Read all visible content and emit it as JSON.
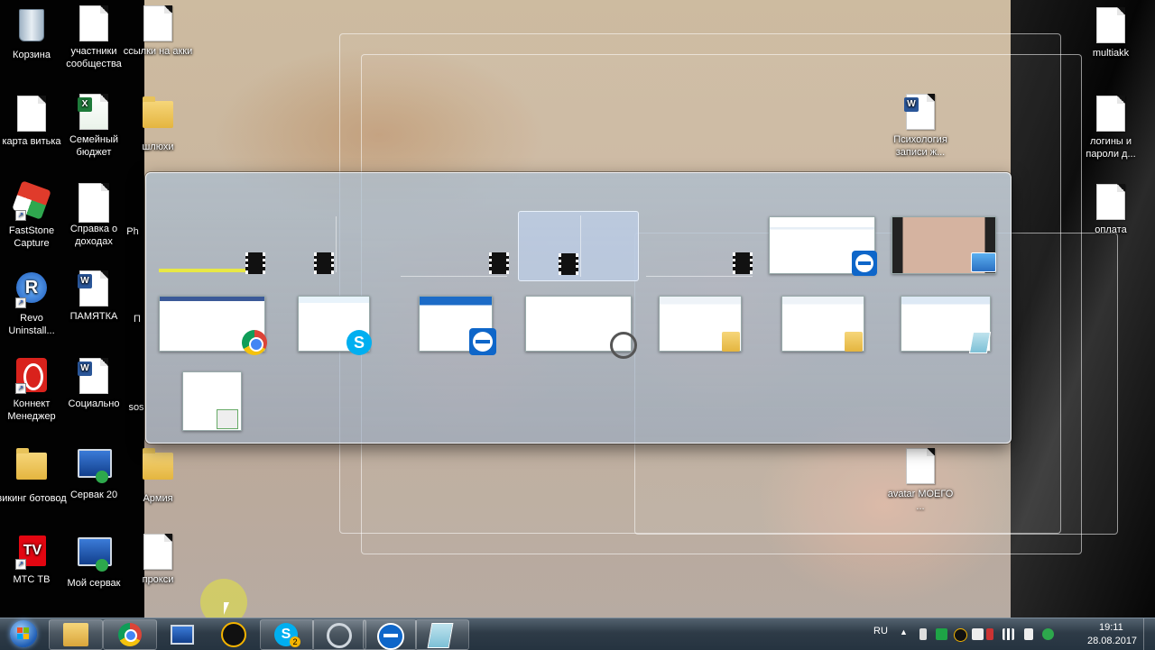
{
  "desktop": {
    "icons": [
      {
        "label": "Корзина",
        "icon": "recycle-bin-icon"
      },
      {
        "label": "участники сообщества",
        "icon": "document-icon"
      },
      {
        "label": "ссылки на акки",
        "icon": "document-icon"
      },
      {
        "label": "карта витька",
        "icon": "document-icon"
      },
      {
        "label": "Семейный бюджет",
        "icon": "excel-document-icon"
      },
      {
        "label": "шлюхи",
        "icon": "folder-icon"
      },
      {
        "label": "FastStone Capture",
        "icon": "faststone-capture-icon"
      },
      {
        "label": "Справка о доходах",
        "icon": "document-icon"
      },
      {
        "label": "Ph",
        "icon": "shortcut-icon"
      },
      {
        "label": "Revo Uninstall...",
        "icon": "revo-uninstaller-icon"
      },
      {
        "label": "ПАМЯТКА",
        "icon": "word-document-icon"
      },
      {
        "label": "П",
        "icon": "folder-icon"
      },
      {
        "label": "Коннект Менеджер",
        "icon": "connect-manager-icon"
      },
      {
        "label": "Социально",
        "icon": "word-document-icon"
      },
      {
        "label": "sos",
        "icon": "document-icon"
      },
      {
        "label": "викинг ботовод",
        "icon": "folder-icon"
      },
      {
        "label": "Сервак 20",
        "icon": "remote-desktop-icon"
      },
      {
        "label": "Армия",
        "icon": "folder-icon"
      },
      {
        "label": "МТС ТВ",
        "icon": "mts-tv-icon"
      },
      {
        "label": "Мой сервак",
        "icon": "remote-desktop-icon"
      },
      {
        "label": "прокси",
        "icon": "document-icon"
      },
      {
        "label": "multiakk",
        "icon": "document-icon"
      },
      {
        "label": "логины и пароли д...",
        "icon": "document-icon"
      },
      {
        "label": "оплата",
        "icon": "document-icon"
      },
      {
        "label": "Психология записи ж...",
        "icon": "word-document-icon"
      },
      {
        "label": "avatar МОЕГО ...",
        "icon": "document-icon"
      }
    ]
  },
  "switcher": {
    "row1": [
      {
        "kind": "video",
        "icon": "film-icon"
      },
      {
        "kind": "video",
        "icon": "film-icon"
      },
      {
        "kind": "video",
        "icon": "film-icon"
      },
      {
        "kind": "video-selected",
        "icon": "film-icon"
      },
      {
        "kind": "video",
        "icon": "film-icon"
      },
      {
        "kind": "window",
        "icon": "teamviewer-icon"
      },
      {
        "kind": "photo",
        "icon": "photo-viewer-icon"
      }
    ],
    "row2": [
      {
        "kind": "window",
        "icon": "chrome-icon"
      },
      {
        "kind": "window",
        "icon": "skype-icon"
      },
      {
        "kind": "window",
        "icon": "teamviewer-icon"
      },
      {
        "kind": "window",
        "icon": "triangle-app-icon"
      },
      {
        "kind": "window",
        "icon": "folder-icon"
      },
      {
        "kind": "window",
        "icon": "folder-icon"
      },
      {
        "kind": "window",
        "icon": "notepad-icon"
      }
    ],
    "row3": [
      {
        "kind": "desktop",
        "icon": "desktop-icon"
      }
    ]
  },
  "taskbar": {
    "start": {
      "icon": "windows-start-icon"
    },
    "pinned": [
      {
        "icon": "explorer-folder-icon"
      },
      {
        "icon": "chrome-icon"
      },
      {
        "icon": "remote-desktop-icon"
      },
      {
        "icon": "triangle-app-icon"
      },
      {
        "icon": "skype-icon",
        "count": "2"
      },
      {
        "icon": "triangle-app-icon"
      },
      {
        "icon": "teamviewer-icon"
      },
      {
        "icon": "notepad-icon"
      }
    ],
    "tray": {
      "language": "RU",
      "time": "19:11",
      "date": "28.08.2017"
    }
  },
  "colors": {
    "taskbar": "#2e3b47",
    "switcher": "#9bb0c8",
    "selection": "#b9cbe6"
  }
}
